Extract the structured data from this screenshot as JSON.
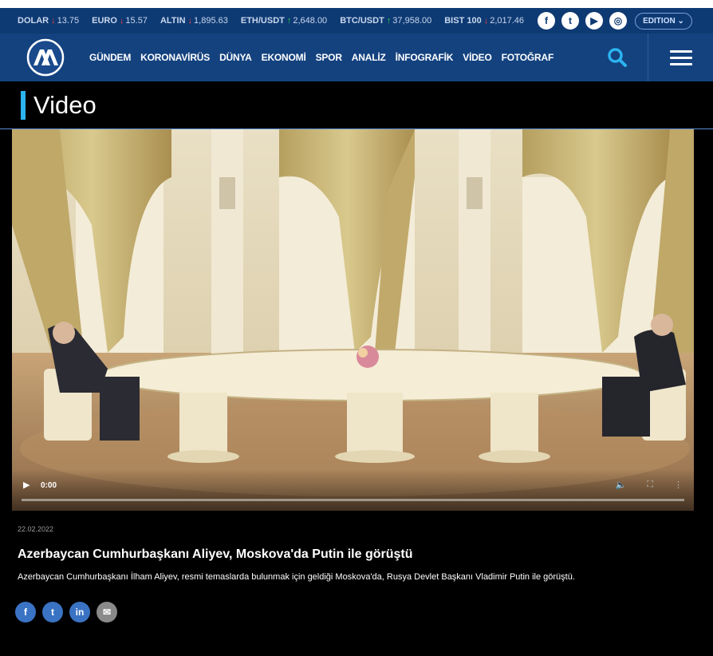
{
  "ticker": [
    {
      "name": "DOLAR",
      "dir": "down",
      "value": "13.75"
    },
    {
      "name": "EURO",
      "dir": "down",
      "value": "15.57"
    },
    {
      "name": "ALTIN",
      "dir": "down",
      "value": "1,895.63"
    },
    {
      "name": "ETH/USDT",
      "dir": "up",
      "value": "2,648.00"
    },
    {
      "name": "BTC/USDT",
      "dir": "up",
      "value": "37,958.00"
    },
    {
      "name": "BIST 100",
      "dir": "down",
      "value": "2,017.46"
    }
  ],
  "arrows": {
    "down": "↓",
    "up": "↑"
  },
  "social_top": [
    {
      "icon": "facebook-icon",
      "glyph": "f"
    },
    {
      "icon": "twitter-icon",
      "glyph": "t"
    },
    {
      "icon": "youtube-icon",
      "glyph": "▶"
    },
    {
      "icon": "instagram-icon",
      "glyph": "◎"
    }
  ],
  "edition_label": "EDITION ⌄",
  "nav": {
    "items": [
      "GÜNDEM",
      "KORONAVİRÜS",
      "DÜNYA",
      "EKONOMİ",
      "SPOR",
      "ANALİZ",
      "İNFOGRAFİK",
      "VİDEO",
      "FOTOĞRAF"
    ],
    "search_icon": "search-icon",
    "menu_icon": "hamburger-icon"
  },
  "section": {
    "title": "Video"
  },
  "video": {
    "time": "0:00",
    "play_glyph": "▶",
    "volume_glyph": "🔈",
    "fullscreen_glyph": "⛶",
    "more_glyph": "⋮"
  },
  "article": {
    "date": "22.02.2022",
    "headline": "Azerbaycan Cumhurbaşkanı Aliyev, Moskova'da Putin ile görüştü",
    "summary": "Azerbaycan Cumhurbaşkanı İlham Aliyev, resmi temaslarda bulunmak için geldiği Moskova'da, Rusya Devlet Başkanı Vladimir Putin ile görüştü."
  },
  "share": [
    {
      "icon": "facebook-icon",
      "glyph": "f"
    },
    {
      "icon": "twitter-icon",
      "glyph": "t"
    },
    {
      "icon": "linkedin-icon",
      "glyph": "in"
    },
    {
      "icon": "mail-icon",
      "glyph": "✉"
    }
  ],
  "colors": {
    "ticker_bg": "#0e3a73",
    "nav_bg": "#14427f",
    "accent": "#2cb4f0",
    "search": "#2cb4f0"
  }
}
